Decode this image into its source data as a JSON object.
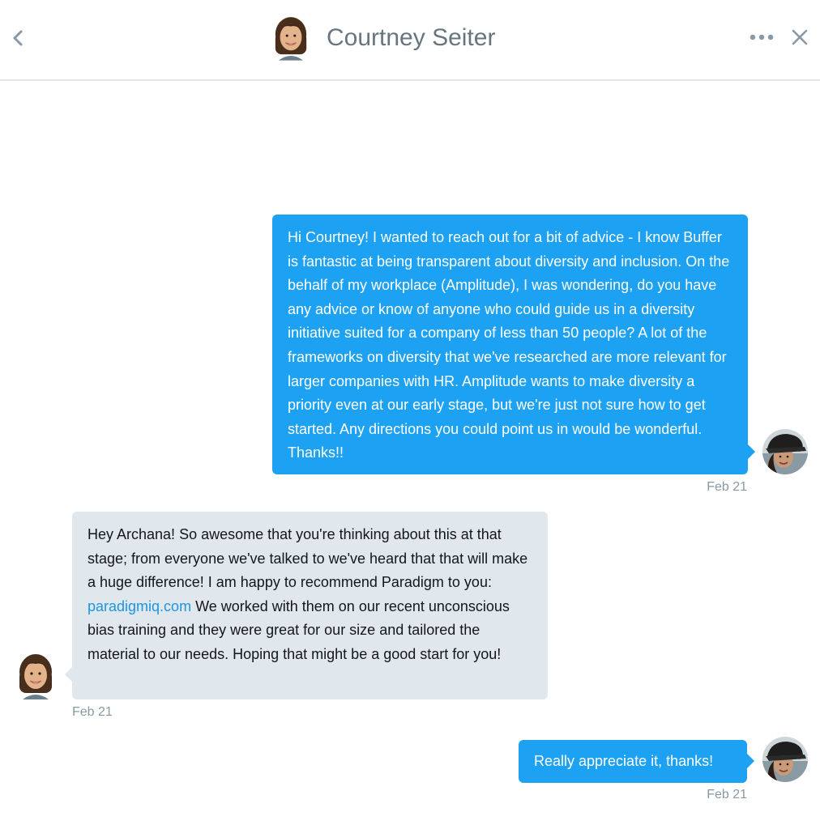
{
  "header": {
    "title": "Courtney Seiter",
    "back_icon": "chevron-left-icon",
    "more_icon": "more-horizontal-icon",
    "close_icon": "close-icon"
  },
  "colors": {
    "accent": "#1da1f2",
    "incoming_bubble": "#e1e8ed",
    "link": "#1b95e0",
    "muted_text": "#8899a6",
    "header_text": "#66757f"
  },
  "messages": [
    {
      "direction": "outgoing",
      "text": "Hi Courtney! I wanted to reach out for a bit of advice - I know Buffer is fantastic at being transparent about diversity and inclusion. On the behalf of my workplace (Amplitude), I was wondering, do you have any advice or know of anyone who could guide us in a diversity initiative suited for a company of less than 50 people? A lot of the frameworks on diversity that we've researched are more relevant for larger companies with HR. Amplitude wants to make diversity a priority even at our early stage, but we're just not sure how to get started. Any directions you could point us in would be wonderful. Thanks!!",
      "timestamp": "Feb 21"
    },
    {
      "direction": "incoming",
      "text_before": "Hey Archana! So awesome that you're thinking about this at that stage; from everyone we've talked to we've heard that that will make a huge difference! I am happy to recommend Paradigm to you: ",
      "link": "paradigmiq.com",
      "text_after": " We worked with them on our recent unconscious bias training and they were great for our size and tailored the material to our needs. Hoping that might be a good start for you!",
      "timestamp": "Feb 21"
    },
    {
      "direction": "outgoing",
      "text": "Really appreciate it, thanks!",
      "timestamp": "Feb 21"
    }
  ]
}
